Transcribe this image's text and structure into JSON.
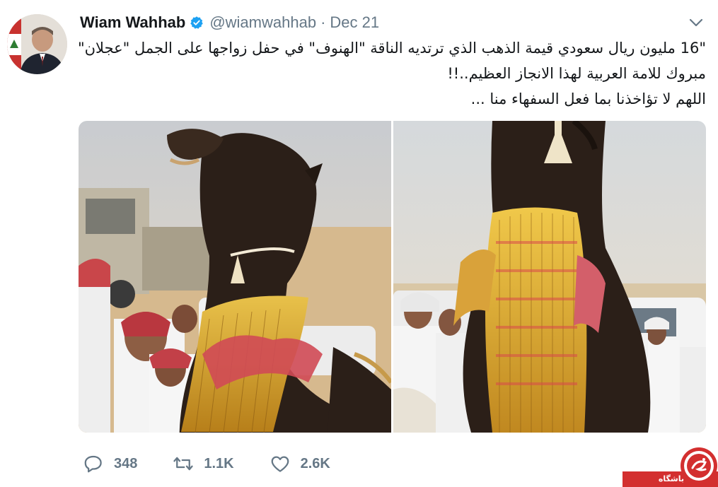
{
  "tweet": {
    "author_name": "Wiam Wahhab",
    "handle": "@wiamwahhab",
    "separator": "·",
    "date": "Dec 21",
    "verified": true,
    "text_lines": [
      "\"16 مليون ريال سعودي قيمة الذهب الذي ترتديه الناقة \"الهنوف\" في حفل زواجها على الجمل \"عجلان\"",
      "مبروك للامة العربية لهذا الانجاز العظيم..!!",
      "اللهم لا تؤاخذنا بما فعل السفهاء منا ..."
    ]
  },
  "actions": {
    "reply_count": "348",
    "retweet_count": "1.1K",
    "like_count": "2.6K"
  },
  "watermark": {
    "text": "باشگاه خبرنگاران"
  },
  "colors": {
    "accent": "#1da1f2",
    "muted": "#657786",
    "watermark_red": "#d32f2f"
  },
  "icons": [
    "verified-badge-icon",
    "chevron-down-icon",
    "reply-icon",
    "retweet-icon",
    "like-icon"
  ]
}
